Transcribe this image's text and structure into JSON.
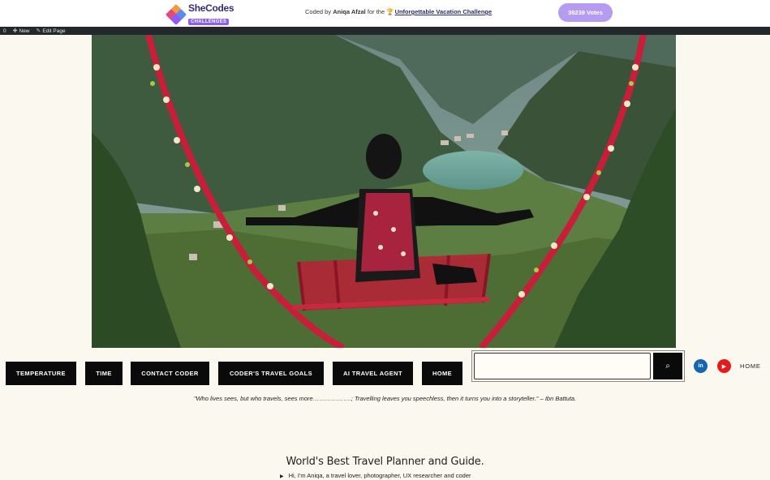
{
  "banner": {
    "logo_name": "SheCodes",
    "logo_tag": "CHALLENGES",
    "credit_prefix": "Coded by",
    "credit_author": "Aniqa Afzal",
    "credit_middle": "for the",
    "credit_trophy": "🏆",
    "credit_challenge": "Unforgettable Vacation Challenge",
    "votes": "39239 Votes"
  },
  "admin_bar": {
    "counter": "0",
    "new_label": "New",
    "edit_label": "Edit Page"
  },
  "nav": {
    "items": [
      "TEMPERATURE",
      "TIME",
      "CONTACT CODER",
      "CODER'S TRAVEL GOALS",
      "AI TRAVEL AGENT",
      "HOME"
    ],
    "search_placeholder": "",
    "search_icon": "⌕",
    "linkedin_icon": "in",
    "youtube_icon": "▶",
    "home_link": "HOME"
  },
  "quote": "\"Who lives sees, but who travels, sees more……………….; Travelling leaves you speechless, then it turns you into a storyteller.\" – Ibn Battuta.",
  "heading": "World's Best Travel Planner and Guide.",
  "intro": "Hi, I'm Aniqa, a travel lover, photographer, UX researcher and coder",
  "colors": {
    "page_bg": "#fbf8ef",
    "nav_bg": "#0a0a0a",
    "votes_bg": "#b59cf0",
    "linkedin": "#1466b3",
    "youtube": "#e61a1a"
  }
}
